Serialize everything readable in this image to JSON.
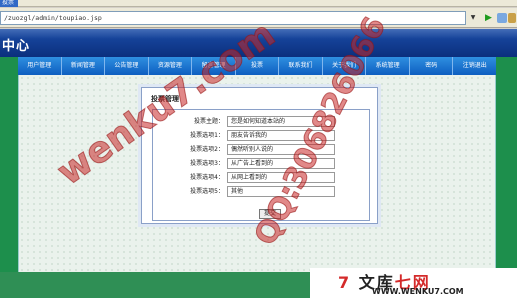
{
  "browser": {
    "tab_label": "投票",
    "address": "/zuozgl/admin/toupiao.jsp"
  },
  "header": {
    "title": "中心"
  },
  "nav": {
    "items": [
      "用户管理",
      "新闻管理",
      "公告管理",
      "资源管理",
      "留言管理",
      "投票",
      "联系我们",
      "关于我们",
      "系统管理",
      "密码",
      "注销退出"
    ]
  },
  "panel": {
    "title": "投票管理",
    "subject_label": "投票主题：",
    "subject_value": "您是如何知道本站的",
    "options": [
      {
        "label": "投票选项1：",
        "value": "朋友告诉我的"
      },
      {
        "label": "投票选项2：",
        "value": "偶然听别人说的"
      },
      {
        "label": "投票选项3：",
        "value": "从广告上看到的"
      },
      {
        "label": "投票选项4：",
        "value": "从网上看到的"
      },
      {
        "label": "投票选项5：",
        "value": "其他"
      }
    ],
    "submit_label": "提交"
  },
  "watermarks": {
    "site": "wenku7.com",
    "qq": "QQ:306826066",
    "logo_prefix": "文库",
    "logo_suffix": "七网",
    "logo_url": "WWW.WENKU7.COM"
  },
  "colors": {
    "banner": "#0b2f7d",
    "nav": "#0d5ec0",
    "side": "#1d8f4c",
    "watermark": "#c82828"
  }
}
